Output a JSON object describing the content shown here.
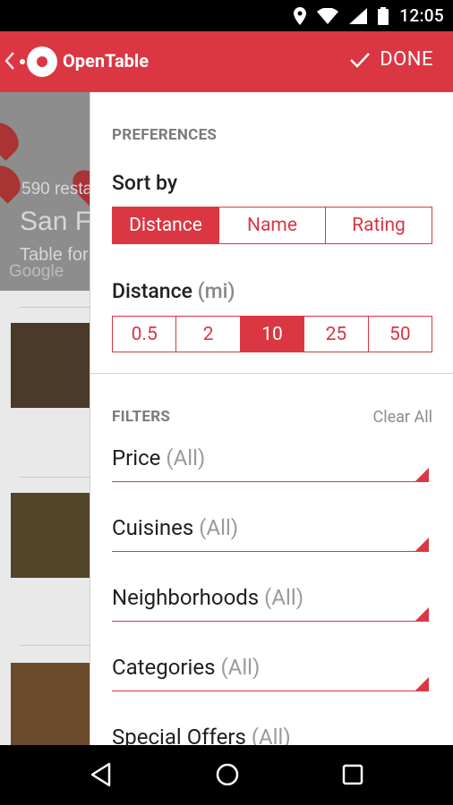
{
  "status": {
    "time": "12:05"
  },
  "app": {
    "title": "OpenTable",
    "done_label": "DONE"
  },
  "background": {
    "count_text": "590 resta",
    "city_text": "San Fr",
    "subtitle_text": "Table for",
    "map_brand": "Google"
  },
  "preferences": {
    "title": "PREFERENCES",
    "sort_label": "Sort by",
    "sort_options": [
      "Distance",
      "Name",
      "Rating"
    ],
    "sort_selected": "Distance",
    "distance_label": "Distance",
    "distance_unit": "(mi)",
    "distance_options": [
      "0.5",
      "2",
      "10",
      "25",
      "50"
    ],
    "distance_selected": "10"
  },
  "filters": {
    "title": "FILTERS",
    "clear_label": "Clear All",
    "items": [
      {
        "label": "Price",
        "value": "(All)"
      },
      {
        "label": "Cuisines",
        "value": "(All)"
      },
      {
        "label": "Neighborhoods",
        "value": "(All)"
      },
      {
        "label": "Categories",
        "value": "(All)"
      },
      {
        "label": "Special Offers",
        "value": "(All)"
      }
    ]
  },
  "colors": {
    "accent": "#da3743"
  }
}
